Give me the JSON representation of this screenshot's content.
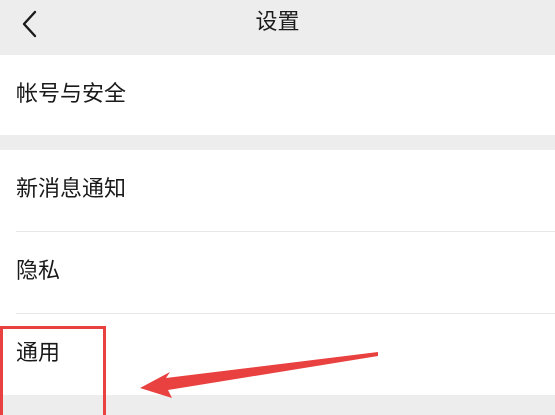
{
  "header": {
    "title": "设置",
    "back_icon": "chevron-left-icon"
  },
  "settings_groups": [
    {
      "items": [
        {
          "label": "帐号与安全"
        }
      ]
    },
    {
      "items": [
        {
          "label": "新消息通知"
        },
        {
          "label": "隐私"
        },
        {
          "label": "通用"
        }
      ]
    }
  ],
  "annotation": {
    "color": "#e8413f",
    "target": "通用"
  }
}
